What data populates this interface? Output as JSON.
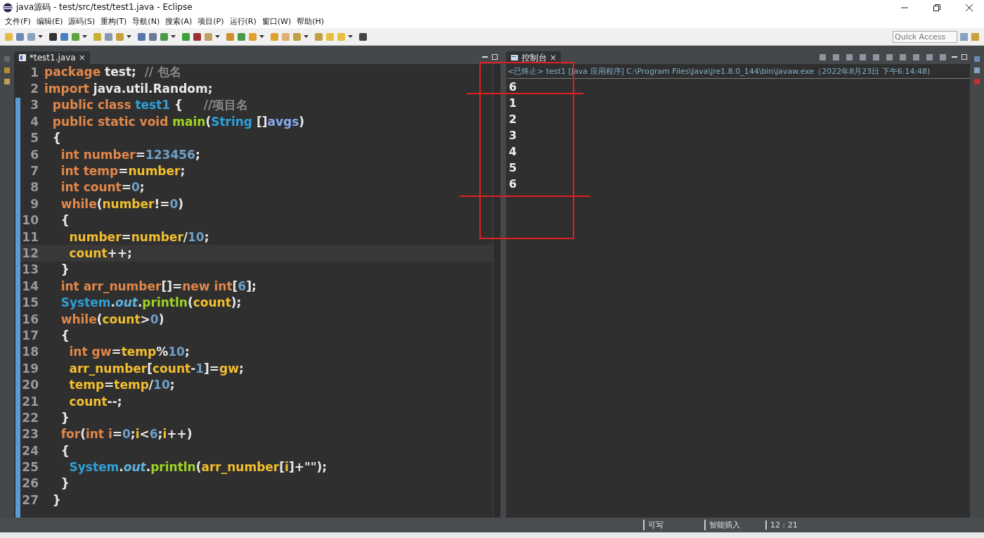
{
  "window": {
    "title": "java源码 - test/src/test/test1.java - Eclipse"
  },
  "menu": [
    "文件(F)",
    "编辑(E)",
    "源码(S)",
    "重构(T)",
    "导航(N)",
    "搜索(A)",
    "项目(P)",
    "运行(R)",
    "窗口(W)",
    "帮助(H)"
  ],
  "quick_access": {
    "placeholder": "Quick Access"
  },
  "editor": {
    "tab": {
      "label": "*test1.java",
      "close": "×",
      "selected": true
    },
    "lines": [
      {
        "number": "1",
        "tokens": [
          {
            "kind": "kw",
            "text": "package"
          },
          {
            "kind": "plain",
            "text": " test;"
          },
          {
            "kind": "comment",
            "text": "  // 包名"
          }
        ]
      },
      {
        "number": "2",
        "tokens": [
          {
            "kind": "kw",
            "text": "import"
          },
          {
            "kind": "plain",
            "text": " java.util.Random;"
          }
        ]
      },
      {
        "number": "3",
        "tokens": [
          {
            "kind": "kw",
            "text": "  public class"
          },
          {
            "kind": "cls",
            "text": " test1"
          },
          {
            "kind": "plain",
            "text": " {"
          },
          {
            "kind": "comment",
            "text": "     //项目名"
          }
        ]
      },
      {
        "number": "4",
        "tokens": [
          {
            "kind": "kw",
            "text": "  public static void"
          },
          {
            "kind": "method",
            "text": " main"
          },
          {
            "kind": "plain",
            "text": "("
          },
          {
            "kind": "cls",
            "text": "String"
          },
          {
            "kind": "plain",
            "text": " []"
          },
          {
            "kind": "param",
            "text": "avgs"
          },
          {
            "kind": "plain",
            "text": ")"
          }
        ]
      },
      {
        "number": "5",
        "tokens": [
          {
            "kind": "plain",
            "text": "  {"
          }
        ]
      },
      {
        "number": "6",
        "tokens": [
          {
            "kind": "kw",
            "text": "    int"
          },
          {
            "kind": "decl",
            "text": " number"
          },
          {
            "kind": "plain",
            "text": "="
          },
          {
            "kind": "num",
            "text": "123456"
          },
          {
            "kind": "plain",
            "text": ";"
          }
        ]
      },
      {
        "number": "7",
        "tokens": [
          {
            "kind": "kw",
            "text": "    int"
          },
          {
            "kind": "decl",
            "text": " temp"
          },
          {
            "kind": "plain",
            "text": "="
          },
          {
            "kind": "var",
            "text": "number"
          },
          {
            "kind": "plain",
            "text": ";"
          }
        ]
      },
      {
        "number": "8",
        "tokens": [
          {
            "kind": "kw",
            "text": "    int"
          },
          {
            "kind": "decl",
            "text": " count"
          },
          {
            "kind": "plain",
            "text": "="
          },
          {
            "kind": "num",
            "text": "0"
          },
          {
            "kind": "plain",
            "text": ";"
          }
        ]
      },
      {
        "number": "9",
        "tokens": [
          {
            "kind": "kw",
            "text": "    while"
          },
          {
            "kind": "plain",
            "text": "("
          },
          {
            "kind": "var",
            "text": "number"
          },
          {
            "kind": "plain",
            "text": "!="
          },
          {
            "kind": "num",
            "text": "0"
          },
          {
            "kind": "plain",
            "text": ")"
          }
        ]
      },
      {
        "number": "10",
        "tokens": [
          {
            "kind": "plain",
            "text": "    {"
          }
        ]
      },
      {
        "number": "11",
        "tokens": [
          {
            "kind": "var",
            "text": "      number"
          },
          {
            "kind": "plain",
            "text": "="
          },
          {
            "kind": "var",
            "text": "number"
          },
          {
            "kind": "plain",
            "text": "/"
          },
          {
            "kind": "num",
            "text": "10"
          },
          {
            "kind": "plain",
            "text": ";"
          }
        ]
      },
      {
        "number": "12",
        "current": true,
        "tokens": [
          {
            "kind": "var",
            "text": "      count"
          },
          {
            "kind": "plain",
            "text": "++;"
          }
        ]
      },
      {
        "number": "13",
        "tokens": [
          {
            "kind": "plain",
            "text": "    }"
          }
        ]
      },
      {
        "number": "14",
        "tokens": [
          {
            "kind": "kw",
            "text": "    int"
          },
          {
            "kind": "decl",
            "text": " arr_number"
          },
          {
            "kind": "plain",
            "text": "[]="
          },
          {
            "kind": "kw",
            "text": "new int"
          },
          {
            "kind": "plain",
            "text": "["
          },
          {
            "kind": "num",
            "text": "6"
          },
          {
            "kind": "plain",
            "text": "];"
          }
        ]
      },
      {
        "number": "15",
        "tokens": [
          {
            "kind": "cls",
            "text": "    System"
          },
          {
            "kind": "plain",
            "text": "."
          },
          {
            "kind": "field",
            "text": "out"
          },
          {
            "kind": "plain",
            "text": "."
          },
          {
            "kind": "method",
            "text": "println"
          },
          {
            "kind": "plain",
            "text": "("
          },
          {
            "kind": "var",
            "text": "count"
          },
          {
            "kind": "plain",
            "text": ");"
          }
        ]
      },
      {
        "number": "16",
        "tokens": [
          {
            "kind": "kw",
            "text": "    while"
          },
          {
            "kind": "plain",
            "text": "("
          },
          {
            "kind": "var",
            "text": "count"
          },
          {
            "kind": "plain",
            "text": ">"
          },
          {
            "kind": "num",
            "text": "0"
          },
          {
            "kind": "plain",
            "text": ")"
          }
        ]
      },
      {
        "number": "17",
        "tokens": [
          {
            "kind": "plain",
            "text": "    {"
          }
        ]
      },
      {
        "number": "18",
        "tokens": [
          {
            "kind": "kw",
            "text": "      int"
          },
          {
            "kind": "decl",
            "text": " gw"
          },
          {
            "kind": "plain",
            "text": "="
          },
          {
            "kind": "var",
            "text": "temp"
          },
          {
            "kind": "plain",
            "text": "%"
          },
          {
            "kind": "num",
            "text": "10"
          },
          {
            "kind": "plain",
            "text": ";"
          }
        ]
      },
      {
        "number": "19",
        "tokens": [
          {
            "kind": "var",
            "text": "      arr_number"
          },
          {
            "kind": "plain",
            "text": "["
          },
          {
            "kind": "var",
            "text": "count"
          },
          {
            "kind": "plain",
            "text": "-"
          },
          {
            "kind": "num",
            "text": "1"
          },
          {
            "kind": "plain",
            "text": "]="
          },
          {
            "kind": "var",
            "text": "gw"
          },
          {
            "kind": "plain",
            "text": ";"
          }
        ]
      },
      {
        "number": "20",
        "tokens": [
          {
            "kind": "var",
            "text": "      temp"
          },
          {
            "kind": "plain",
            "text": "="
          },
          {
            "kind": "var",
            "text": "temp"
          },
          {
            "kind": "plain",
            "text": "/"
          },
          {
            "kind": "num",
            "text": "10"
          },
          {
            "kind": "plain",
            "text": ";"
          }
        ]
      },
      {
        "number": "21",
        "tokens": [
          {
            "kind": "var",
            "text": "      count"
          },
          {
            "kind": "plain",
            "text": "--;"
          }
        ]
      },
      {
        "number": "22",
        "tokens": [
          {
            "kind": "plain",
            "text": "    }"
          }
        ]
      },
      {
        "number": "23",
        "tokens": [
          {
            "kind": "kw",
            "text": "    for"
          },
          {
            "kind": "plain",
            "text": "("
          },
          {
            "kind": "kw",
            "text": "int"
          },
          {
            "kind": "decl",
            "text": " i"
          },
          {
            "kind": "plain",
            "text": "="
          },
          {
            "kind": "num",
            "text": "0"
          },
          {
            "kind": "plain",
            "text": ";"
          },
          {
            "kind": "var",
            "text": "i"
          },
          {
            "kind": "plain",
            "text": "<"
          },
          {
            "kind": "num",
            "text": "6"
          },
          {
            "kind": "plain",
            "text": ";"
          },
          {
            "kind": "var",
            "text": "i"
          },
          {
            "kind": "plain",
            "text": "++)"
          }
        ]
      },
      {
        "number": "24",
        "tokens": [
          {
            "kind": "plain",
            "text": "    {"
          }
        ]
      },
      {
        "number": "25",
        "tokens": [
          {
            "kind": "cls",
            "text": "      System"
          },
          {
            "kind": "plain",
            "text": "."
          },
          {
            "kind": "field",
            "text": "out"
          },
          {
            "kind": "plain",
            "text": "."
          },
          {
            "kind": "method",
            "text": "println"
          },
          {
            "kind": "plain",
            "text": "("
          },
          {
            "kind": "var",
            "text": "arr_number"
          },
          {
            "kind": "plain",
            "text": "["
          },
          {
            "kind": "var",
            "text": "i"
          },
          {
            "kind": "plain",
            "text": "]+\"\");"
          }
        ]
      },
      {
        "number": "26",
        "tokens": [
          {
            "kind": "plain",
            "text": "    }"
          }
        ]
      },
      {
        "number": "27",
        "tokens": [
          {
            "kind": "plain",
            "text": "  }"
          }
        ]
      }
    ]
  },
  "console": {
    "tab": {
      "label": "控制台",
      "close": "×",
      "selected": true
    },
    "header": "<已终止> test1 [Java 应用程序] C:\\Program Files\\Java\\jre1.8.0_144\\bin\\javaw.exe（2022年8月23日 下午6:14:48)",
    "output": [
      "6",
      "1",
      "2",
      "3",
      "4",
      "5",
      "6"
    ],
    "markup": {
      "color": "#e02020"
    }
  },
  "status_bar": {
    "mode": "可写",
    "insert": "智能插入",
    "position": "12 : 21"
  }
}
